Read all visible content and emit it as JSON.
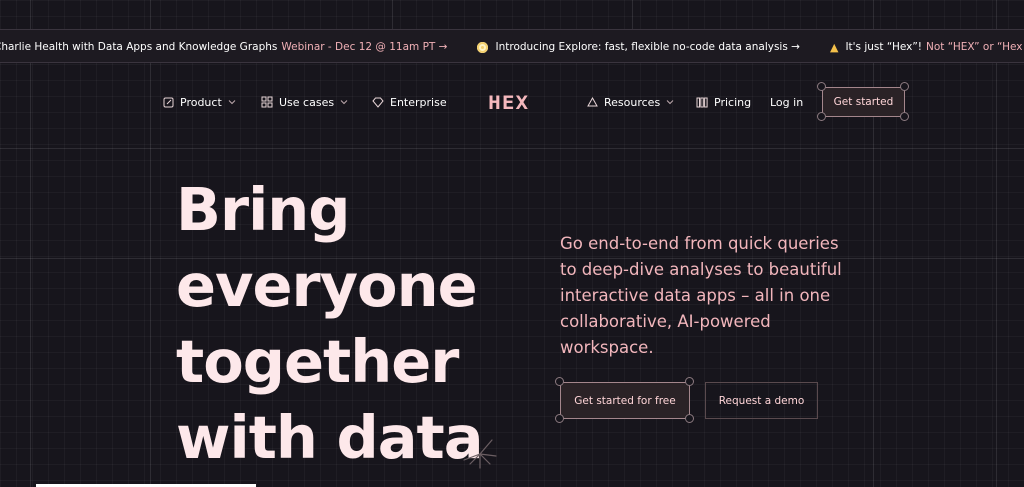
{
  "announcement": {
    "items": [
      {
        "main": "Charlie Health with Data Apps and Knowledge Graphs",
        "sub": "Webinar - Dec 12 @ 11am PT →",
        "emoji": ""
      },
      {
        "main": "Introducing Explore: fast, flexible no-code data analysis →",
        "sub": "",
        "emoji": "clock-icon"
      },
      {
        "main": "It's just “Hex”!",
        "sub": "Not “HEX” or “Hex d",
        "emoji": "pray-icon"
      }
    ]
  },
  "nav": {
    "product": "Product",
    "use_cases": "Use cases",
    "enterprise": "Enterprise",
    "logo": "HEX",
    "resources": "Resources",
    "pricing": "Pricing",
    "login": "Log in",
    "get_started": "Get started"
  },
  "hero": {
    "headline": [
      "Bring",
      "everyone",
      "together",
      "with data"
    ],
    "subheading": "Go end-to-end from quick queries to deep-dive analyses to beautiful interactive data apps – all in one collaborative, AI-powered workspace.",
    "cta_primary": "Get started for free",
    "cta_secondary": "Request a demo"
  },
  "colors": {
    "background": "#17151c",
    "accent_pink": "#f5b8bd",
    "headline": "#fde8ea"
  }
}
